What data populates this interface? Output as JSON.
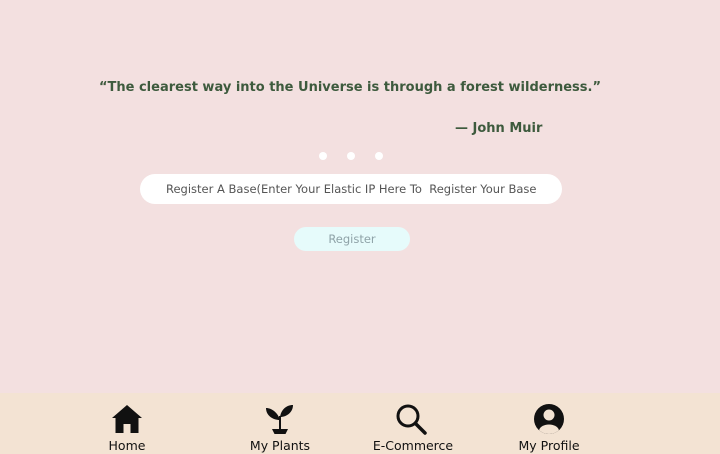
{
  "quote": {
    "text": "“The clearest way into the Universe is through a forest wilderness.”",
    "author": "— John Muir"
  },
  "carousel": {
    "dot_count": 3
  },
  "register_form": {
    "ip_placeholder": "Register A Base(Enter Your Elastic IP Here To  Register Your Base)",
    "ip_value": "",
    "button_label": "Register"
  },
  "nav": {
    "items": [
      {
        "label": "Home",
        "icon": "home-icon"
      },
      {
        "label": "My Plants",
        "icon": "sprout-icon"
      },
      {
        "label": "E-Commerce",
        "icon": "search-icon"
      },
      {
        "label": "My Profile",
        "icon": "profile-icon"
      }
    ]
  },
  "colors": {
    "background": "#f3e0e0",
    "quote_text": "#3d5a3d",
    "navbar_background": "#f3e3d3",
    "input_background": "#ffffff",
    "button_background": "#e6fbfb",
    "button_text": "#8fa3a8"
  }
}
